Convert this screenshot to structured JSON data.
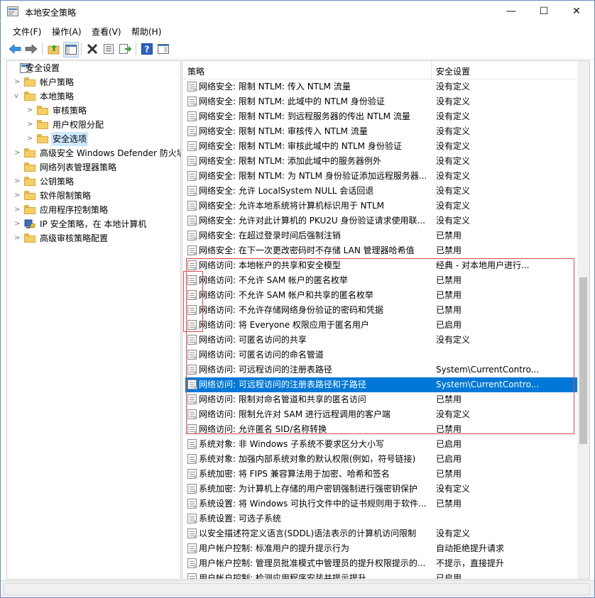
{
  "window": {
    "title": "本地安全策略",
    "min_glyph": "—",
    "max_glyph": "☐",
    "close_glyph": "✕"
  },
  "menu": [
    "文件(F)",
    "操作(A)",
    "查看(V)",
    "帮助(H)"
  ],
  "tree": [
    {
      "label": "安全设置",
      "level": 0,
      "expander": "",
      "icon": "security-settings-icon"
    },
    {
      "label": "帐户策略",
      "level": 1,
      "expander": ">",
      "icon": "folder-icon"
    },
    {
      "label": "本地策略",
      "level": 1,
      "expander": "v",
      "icon": "folder-icon"
    },
    {
      "label": "审核策略",
      "level": 2,
      "expander": ">",
      "icon": "folder-icon"
    },
    {
      "label": "用户权限分配",
      "level": 2,
      "expander": ">",
      "icon": "folder-icon"
    },
    {
      "label": "安全选项",
      "level": 2,
      "expander": ">",
      "icon": "folder-icon",
      "selected": true
    },
    {
      "label": "高级安全 Windows Defender 防火墙",
      "level": 1,
      "expander": ">",
      "icon": "folder-icon"
    },
    {
      "label": "网络列表管理器策略",
      "level": 1,
      "expander": "",
      "icon": "folder-icon"
    },
    {
      "label": "公钥策略",
      "level": 1,
      "expander": ">",
      "icon": "folder-icon"
    },
    {
      "label": "软件限制策略",
      "level": 1,
      "expander": ">",
      "icon": "folder-icon"
    },
    {
      "label": "应用程序控制策略",
      "level": 1,
      "expander": ">",
      "icon": "folder-icon"
    },
    {
      "label": "IP 安全策略，在 本地计算机",
      "level": 1,
      "expander": ">",
      "icon": "ip-security-icon"
    },
    {
      "label": "高级审核策略配置",
      "level": 1,
      "expander": ">",
      "icon": "folder-icon"
    }
  ],
  "columns": {
    "policy": "策略",
    "setting": "安全设置"
  },
  "rows": [
    {
      "name": "网络安全: 限制 NTLM: 传入 NTLM 流量",
      "value": "没有定义"
    },
    {
      "name": "网络安全: 限制 NTLM: 此域中的 NTLM 身份验证",
      "value": "没有定义"
    },
    {
      "name": "网络安全: 限制 NTLM: 到远程服务器的传出 NTLM 流量",
      "value": "没有定义"
    },
    {
      "name": "网络安全: 限制 NTLM: 审核传入 NTLM 流量",
      "value": "没有定义"
    },
    {
      "name": "网络安全: 限制 NTLM: 审核此域中的 NTLM 身份验证",
      "value": "没有定义"
    },
    {
      "name": "网络安全: 限制 NTLM: 添加此域中的服务器例外",
      "value": "没有定义"
    },
    {
      "name": "网络安全: 限制 NTLM: 为 NTLM 身份验证添加远程服务器...",
      "value": "没有定义"
    },
    {
      "name": "网络安全: 允许 LocalSystem NULL 会话回退",
      "value": "没有定义"
    },
    {
      "name": "网络安全: 允许本地系统将计算机标识用于 NTLM",
      "value": "没有定义"
    },
    {
      "name": "网络安全: 允许对此计算机的 PKU2U 身份验证请求使用联...",
      "value": "没有定义"
    },
    {
      "name": "网络安全: 在超过登录时间后强制注销",
      "value": "已禁用"
    },
    {
      "name": "网络安全: 在下一次更改密码时不存储 LAN 管理器哈希值",
      "value": "已禁用"
    },
    {
      "name": "网络访问: 本地帐户的共享和安全模型",
      "value": "经典 - 对本地用户进行..."
    },
    {
      "name": "网络访问: 不允许 SAM 帐户的匿名枚举",
      "value": "已禁用"
    },
    {
      "name": "网络访问: 不允许 SAM 帐户和共享的匿名枚举",
      "value": "已禁用"
    },
    {
      "name": "网络访问: 不允许存储网络身份验证的密码和凭据",
      "value": "已禁用"
    },
    {
      "name": "网络访问: 将 Everyone 权限应用于匿名用户",
      "value": "已启用"
    },
    {
      "name": "网络访问: 可匿名访问的共享",
      "value": "没有定义"
    },
    {
      "name": "网络访问: 可匿名访问的命名管道",
      "value": ""
    },
    {
      "name": "网络访问: 可远程访问的注册表路径",
      "value": "System\\CurrentContro..."
    },
    {
      "name": "网络访问: 可远程访问的注册表路径和子路径",
      "value": "System\\CurrentContro...",
      "selected": true
    },
    {
      "name": "网络访问: 限制对命名管道和共享的匿名访问",
      "value": "已禁用"
    },
    {
      "name": "网络访问: 限制允许对 SAM 进行远程调用的客户端",
      "value": "没有定义"
    },
    {
      "name": "网络访问: 允许匿名 SID/名称转换",
      "value": "已禁用"
    },
    {
      "name": "系统对象: 非 Windows 子系统不要求区分大小写",
      "value": "已启用"
    },
    {
      "name": "系统对象: 加强内部系统对象的默认权限(例如，符号链接)",
      "value": "已启用"
    },
    {
      "name": "系统加密: 将 FIPS 兼容算法用于加密、哈希和签名",
      "value": "已禁用"
    },
    {
      "name": "系统加密: 为计算机上存储的用户密钥强制进行强密钥保护",
      "value": "没有定义"
    },
    {
      "name": "系统设置: 将 Windows 可执行文件中的证书规则用于软件...",
      "value": "已禁用"
    },
    {
      "name": "系统设置: 可选子系统",
      "value": ""
    },
    {
      "name": "以安全描述符定义语言(SDDL)语法表示的计算机访问限制",
      "value": "没有定义"
    },
    {
      "name": "用户帐户控制: 标准用户的提升提示行为",
      "value": "自动拒绝提升请求"
    },
    {
      "name": "用户帐户控制: 管理员批准模式中管理员的提升权限提示的...",
      "value": "不提示，直接提升"
    },
    {
      "name": "用户帐户控制: 检测应用程序安装并提示提升",
      "value": "已启用"
    }
  ],
  "colors": {
    "selection": "#0078d7",
    "tree_selection": "#cce8ff",
    "annotation": "#e0464c"
  }
}
